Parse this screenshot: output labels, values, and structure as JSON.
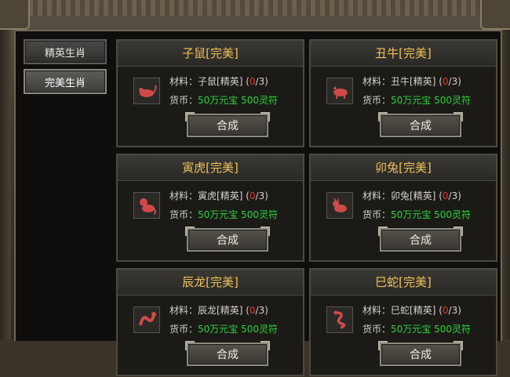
{
  "sidebar": {
    "items": [
      {
        "label": "精英生肖",
        "active": false
      },
      {
        "label": "完美生肖",
        "active": true
      }
    ]
  },
  "cards": [
    {
      "title": "子鼠[完美]",
      "material_prefix": "材料：",
      "material_name": "子鼠[精英]",
      "paren_open": "(",
      "have": "0",
      "need": "/3)",
      "currency_prefix": "货币：",
      "currency_value": "50万元宝 500灵符",
      "button": "合成",
      "icon": "rat-icon"
    },
    {
      "title": "丑牛[完美]",
      "material_prefix": "材料：",
      "material_name": "丑牛[精英]",
      "paren_open": "(",
      "have": "0",
      "need": "/3)",
      "currency_prefix": "货币：",
      "currency_value": "50万元宝 500灵符",
      "button": "合成",
      "icon": "ox-icon"
    },
    {
      "title": "寅虎[完美]",
      "material_prefix": "材料：",
      "material_name": "寅虎[精英]",
      "paren_open": "(",
      "have": "0",
      "need": "/3)",
      "currency_prefix": "货币：",
      "currency_value": "50万元宝 500灵符",
      "button": "合成",
      "icon": "tiger-icon"
    },
    {
      "title": "卯兔[完美]",
      "material_prefix": "材料：",
      "material_name": "卯兔[精英]",
      "paren_open": "(",
      "have": "0",
      "need": "/3)",
      "currency_prefix": "货币：",
      "currency_value": "50万元宝 500灵符",
      "button": "合成",
      "icon": "rabbit-icon"
    },
    {
      "title": "辰龙[完美]",
      "material_prefix": "材料：",
      "material_name": "辰龙[精英]",
      "paren_open": "(",
      "have": "0",
      "need": "/3)",
      "currency_prefix": "货币：",
      "currency_value": "50万元宝 500灵符",
      "button": "合成",
      "icon": "dragon-icon"
    },
    {
      "title": "巳蛇[完美]",
      "material_prefix": "材料：",
      "material_name": "巳蛇[精英]",
      "paren_open": "(",
      "have": "0",
      "need": "/3)",
      "currency_prefix": "货币：",
      "currency_value": "50万元宝 500灵符",
      "button": "合成",
      "icon": "snake-icon"
    }
  ],
  "colors": {
    "title_gold": "#f1c15a",
    "count_red": "#e23a2a",
    "currency_green": "#2cd43a",
    "zodiac_red": "#d04a4a"
  }
}
